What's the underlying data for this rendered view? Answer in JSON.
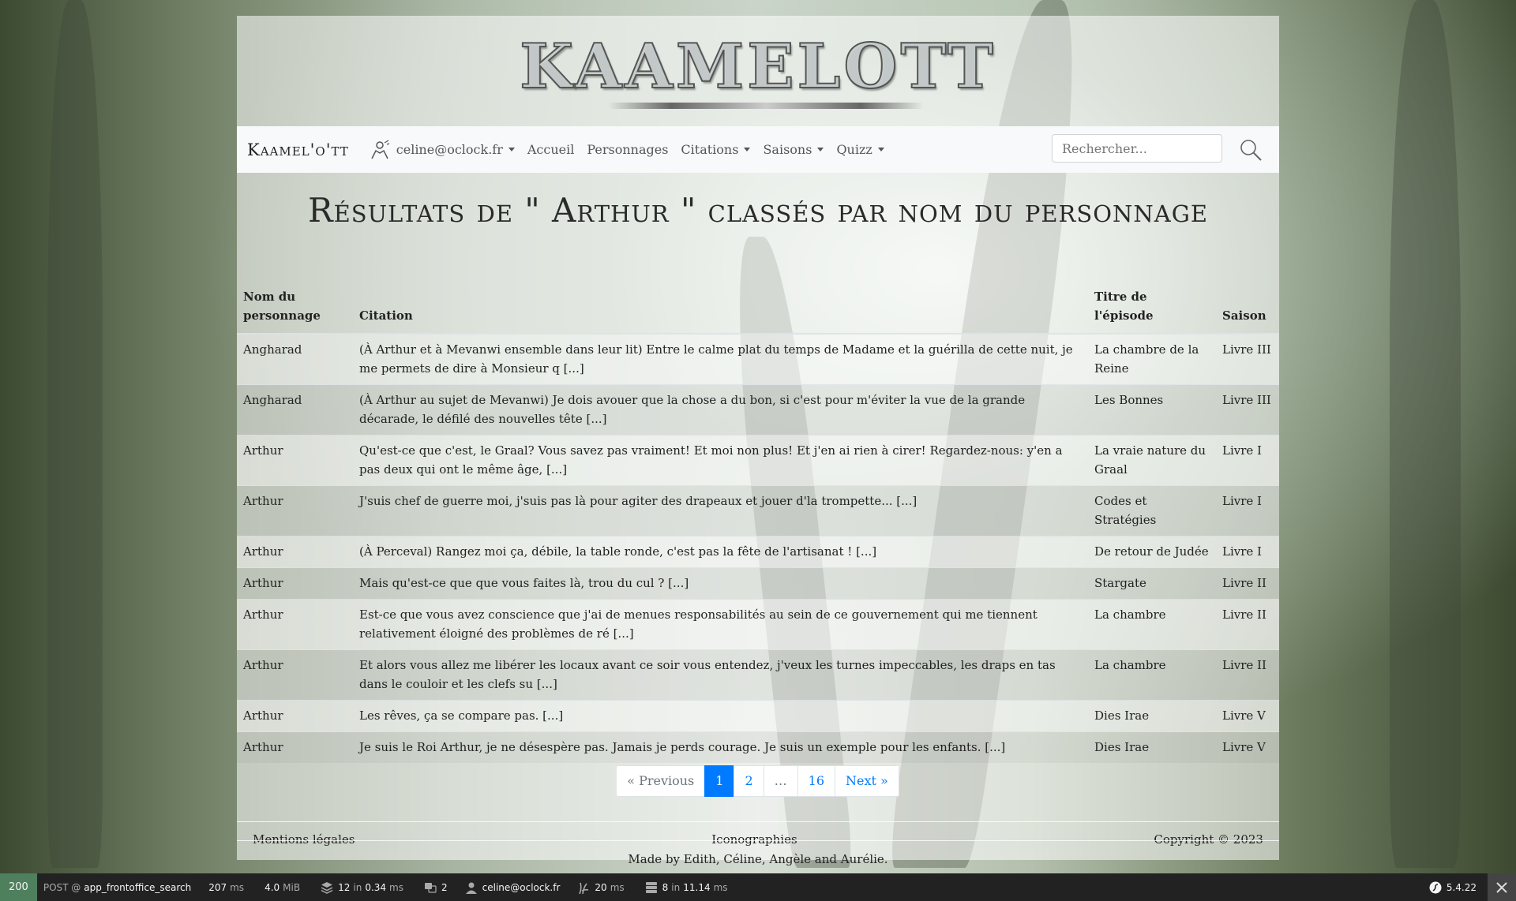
{
  "logo": {
    "text": "KAAMELOTT"
  },
  "navbar": {
    "brand": "Kaamel'o'tt",
    "user": "celine@oclock.fr",
    "items": [
      "Accueil",
      "Personnages",
      "Citations",
      "Saisons",
      "Quizz"
    ],
    "search_placeholder": "Rechercher..."
  },
  "page_title": "Résultats de \" Arthur \" classés par nom du personnage",
  "table": {
    "headers": [
      "Nom du personnage",
      "Citation",
      "Titre de l'épisode",
      "Saison"
    ],
    "rows": [
      [
        "Angharad",
        "(À Arthur et à Mevanwi ensemble dans leur lit) Entre le calme plat du temps de Madame et la guérilla de cette nuit, je me permets de dire à Monsieur q [...]",
        "La chambre de la Reine",
        "Livre III"
      ],
      [
        "Angharad",
        "(À Arthur au sujet de Mevanwi) Je dois avouer que la chose a du bon, si c'est pour m'éviter la vue de la grande décarade, le défilé des nouvelles tête [...]",
        "Les Bonnes",
        "Livre III"
      ],
      [
        "Arthur",
        "Qu'est-ce que c'est, le Graal? Vous savez pas vraiment! Et moi non plus! Et j'en ai rien à cirer! Regardez-nous: y'en a pas deux qui ont le même âge, [...]",
        "La vraie nature du Graal",
        "Livre I"
      ],
      [
        "Arthur",
        "J'suis chef de guerre moi, j'suis pas là pour agiter des drapeaux et jouer d'la trompette... [...]",
        "Codes et Stratégies",
        "Livre I"
      ],
      [
        "Arthur",
        "(À Perceval) Rangez moi ça, débile, la table ronde, c'est pas la fête de l'artisanat ! [...]",
        "De retour de Judée",
        "Livre I"
      ],
      [
        "Arthur",
        "Mais qu'est-ce que que vous faites là, trou du cul ? [...]",
        "Stargate",
        "Livre II"
      ],
      [
        "Arthur",
        "Est-ce que vous avez conscience que j'ai de menues responsabilités au sein de ce gouvernement qui me tiennent relativement éloigné des problèmes de ré [...]",
        "La chambre",
        "Livre II"
      ],
      [
        "Arthur",
        "Et alors vous allez me libérer les locaux avant ce soir vous entendez, j'veux les turnes impeccables, les draps en tas dans le couloir et les clefs su [...]",
        "La chambre",
        "Livre II"
      ],
      [
        "Arthur",
        "Les rêves, ça se compare pas. [...]",
        "Dies Irae",
        "Livre V"
      ],
      [
        "Arthur",
        "Je suis le Roi Arthur, je ne désespère pas. Jamais je perds courage. Je suis un exemple pour les enfants. [...]",
        "Dies Irae",
        "Livre V"
      ]
    ]
  },
  "pagination": [
    "« Previous",
    "1",
    "2",
    "…",
    "16",
    "Next »"
  ],
  "footer": {
    "left": "Mentions légales",
    "center": "Iconographies",
    "right": "Copyright © 2023",
    "made_by": "Made by Edith, Céline, Angèle and Aurélie."
  },
  "debug_toolbar": {
    "status": "200",
    "method": "POST @",
    "route": "app_frontoffice_search",
    "time": "207",
    "time_unit": "ms",
    "memory": "4.0",
    "memory_unit": "MiB",
    "queries": "12",
    "queries_in": "in",
    "queries_time": "0.34",
    "queries_unit": "ms",
    "translations": "2",
    "user": "celine@oclock.fr",
    "twig_time": "20",
    "twig_unit": "ms",
    "cache": "8",
    "cache_in": "in",
    "cache_time": "11.14",
    "cache_unit": "ms",
    "symfony_version": "5.4.22"
  }
}
